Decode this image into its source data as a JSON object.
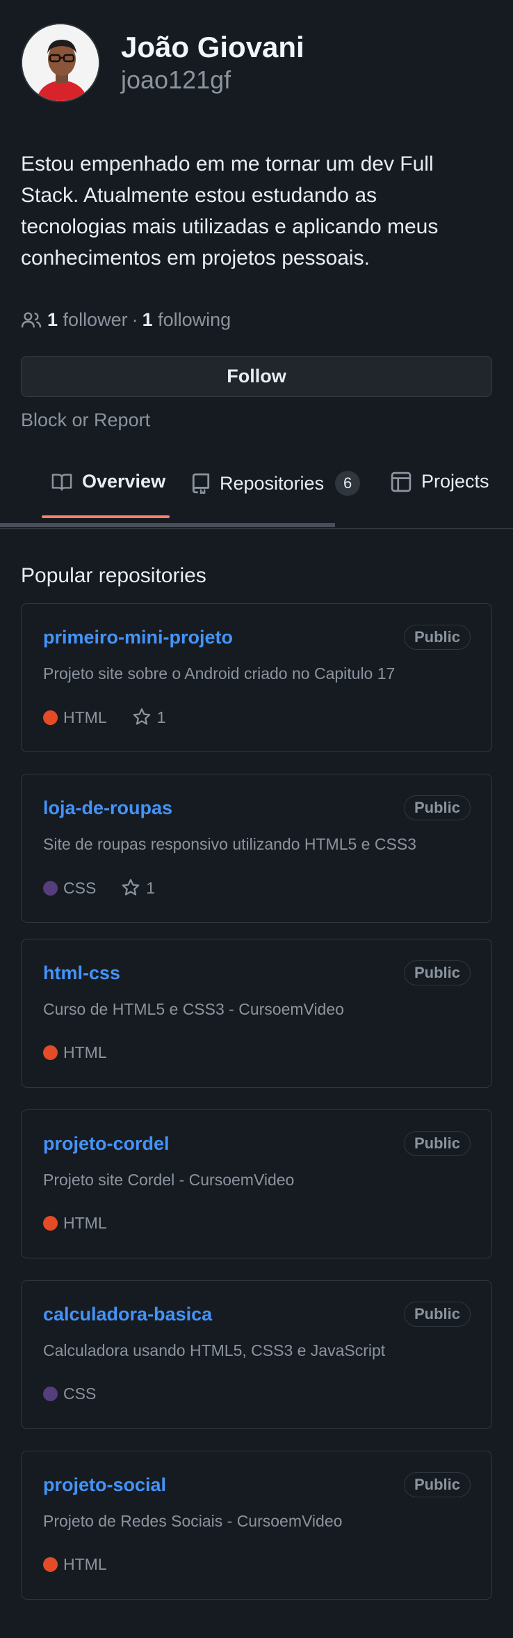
{
  "profile": {
    "full_name": "João Giovani",
    "username": "joao121gf",
    "bio": "Estou empenhado em me tornar um dev Full Stack. Atualmente estou estudando as tecnologias mais utilizadas e aplicando meus conhecimentos em projetos pessoais.",
    "followers_count": "1",
    "followers_label": "follower",
    "separator": "·",
    "following_count": "1",
    "following_label": "following",
    "follow_button": "Follow",
    "block_link": "Block or Report"
  },
  "tabs": {
    "overview": "Overview",
    "repositories": "Repositories",
    "repositories_count": "6",
    "projects": "Projects"
  },
  "section_title": "Popular repositories",
  "colors": {
    "html": "#e34c26",
    "css": "#563d7c",
    "accent_underline": "#f78166",
    "link": "#4493f8"
  },
  "repos": [
    {
      "name": "primeiro-mini-projeto",
      "visibility": "Public",
      "description": "Projeto site sobre o Android criado no Capitulo 17",
      "language": "HTML",
      "stars": "1"
    },
    {
      "name": "loja-de-roupas",
      "visibility": "Public",
      "description": "Site de roupas responsivo utilizando HTML5 e CSS3",
      "language": "CSS",
      "stars": "1"
    },
    {
      "name": "html-css",
      "visibility": "Public",
      "description": "Curso de HTML5 e CSS3 - CursoemVideo",
      "language": "HTML"
    },
    {
      "name": "projeto-cordel",
      "visibility": "Public",
      "description": "Projeto site Cordel - CursoemVideo",
      "language": "HTML"
    },
    {
      "name": "calculadora-basica",
      "visibility": "Public",
      "description": "Calculadora usando HTML5, CSS3 e JavaScript",
      "language": "CSS"
    },
    {
      "name": "projeto-social",
      "visibility": "Public",
      "description": "Projeto de Redes Sociais - CursoemVideo",
      "language": "HTML"
    }
  ]
}
